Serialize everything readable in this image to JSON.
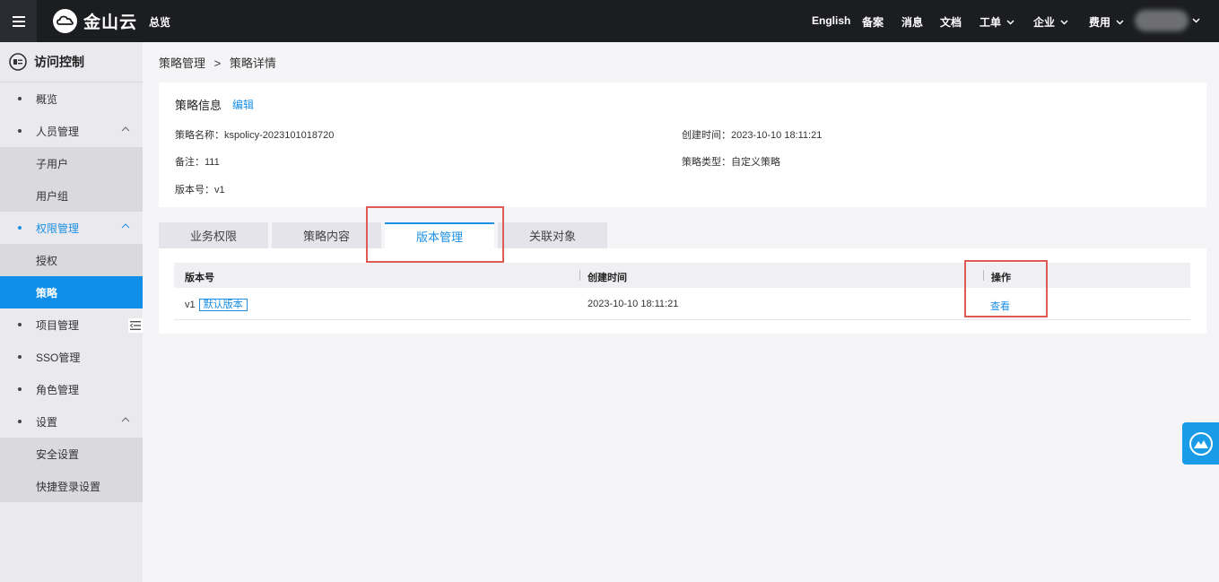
{
  "topbar": {
    "brand": "金山云",
    "overview": "总览",
    "nav": [
      {
        "label": "English"
      },
      {
        "label": "备案"
      },
      {
        "label": "消息"
      },
      {
        "label": "文档"
      },
      {
        "label": "工单"
      },
      {
        "label": "企业"
      },
      {
        "label": "费用"
      }
    ]
  },
  "sidebar": {
    "title": "访问控制",
    "items": [
      {
        "label": "概览"
      },
      {
        "label": "人员管理"
      },
      {
        "label": "子用户"
      },
      {
        "label": "用户组"
      },
      {
        "label": "权限管理"
      },
      {
        "label": "授权"
      },
      {
        "label": "策略"
      },
      {
        "label": "项目管理"
      },
      {
        "label": "SSO管理"
      },
      {
        "label": "角色管理"
      },
      {
        "label": "设置"
      },
      {
        "label": "安全设置"
      },
      {
        "label": "快捷登录设置"
      }
    ]
  },
  "breadcrumb": {
    "parent": "策略管理",
    "sep": ">",
    "current": "策略详情"
  },
  "info": {
    "title": "策略信息",
    "edit": "编辑",
    "name": "策略名称：kspolicy-2023101018720",
    "created": "创建时间：2023-10-10 18:11:21",
    "remark": "备注：111",
    "type": "策略类型：自定义策略",
    "version": "版本号：v1"
  },
  "tabs": [
    {
      "label": "业务权限"
    },
    {
      "label": "策略内容"
    },
    {
      "label": "版本管理"
    },
    {
      "label": "关联对象"
    }
  ],
  "table": {
    "headers": {
      "version": "版本号",
      "created": "创建时间",
      "action": "操作"
    },
    "rows": [
      {
        "version": "v1",
        "badge": "默认版本",
        "created": "2023-10-10 18:11:21",
        "action": "查看"
      }
    ]
  },
  "colors": {
    "accent": "#1a8fe3",
    "topbar": "#1c1d21",
    "highlight": "#e05a55"
  }
}
